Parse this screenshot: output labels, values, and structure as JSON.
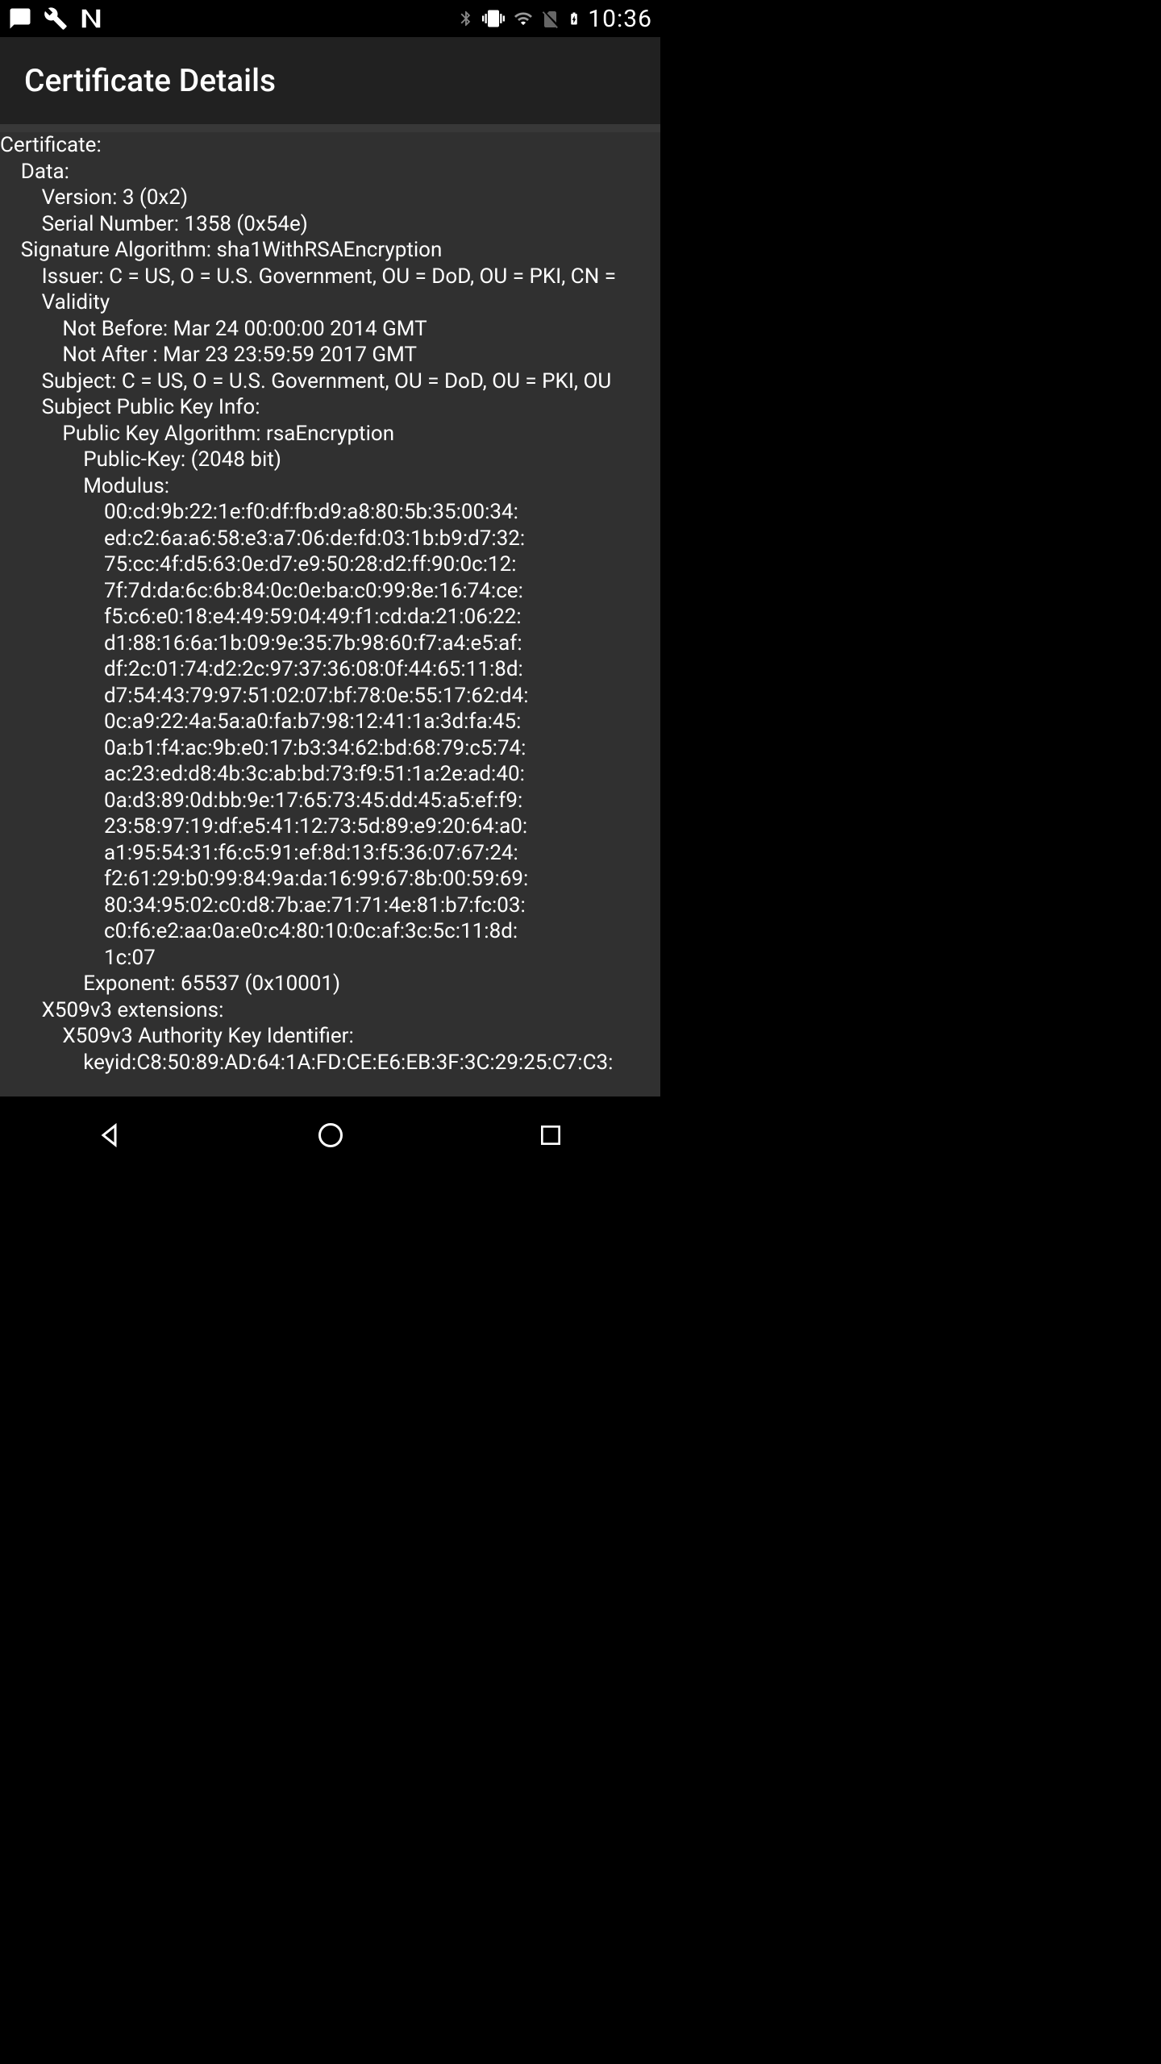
{
  "status": {
    "clock": "10:36"
  },
  "header": {
    "title": "Certificate Details"
  },
  "certificate": {
    "lines": [
      "Certificate:",
      "    Data:",
      "        Version: 3 (0x2)",
      "        Serial Number: 1358 (0x54e)",
      "    Signature Algorithm: sha1WithRSAEncryption",
      "        Issuer: C = US, O = U.S. Government, OU = DoD, OU = PKI, CN = ",
      "        Validity",
      "            Not Before: Mar 24 00:00:00 2014 GMT",
      "            Not After : Mar 23 23:59:59 2017 GMT",
      "        Subject: C = US, O = U.S. Government, OU = DoD, OU = PKI, OU ",
      "        Subject Public Key Info:",
      "            Public Key Algorithm: rsaEncryption",
      "                Public-Key: (2048 bit)",
      "                Modulus:",
      "                    00:cd:9b:22:1e:f0:df:fb:d9:a8:80:5b:35:00:34:",
      "                    ed:c2:6a:a6:58:e3:a7:06:de:fd:03:1b:b9:d7:32:",
      "                    75:cc:4f:d5:63:0e:d7:e9:50:28:d2:ff:90:0c:12:",
      "                    7f:7d:da:6c:6b:84:0c:0e:ba:c0:99:8e:16:74:ce:",
      "                    f5:c6:e0:18:e4:49:59:04:49:f1:cd:da:21:06:22:",
      "                    d1:88:16:6a:1b:09:9e:35:7b:98:60:f7:a4:e5:af:",
      "                    df:2c:01:74:d2:2c:97:37:36:08:0f:44:65:11:8d:",
      "                    d7:54:43:79:97:51:02:07:bf:78:0e:55:17:62:d4:",
      "                    0c:a9:22:4a:5a:a0:fa:b7:98:12:41:1a:3d:fa:45:",
      "                    0a:b1:f4:ac:9b:e0:17:b3:34:62:bd:68:79:c5:74:",
      "                    ac:23:ed:d8:4b:3c:ab:bd:73:f9:51:1a:2e:ad:40:",
      "                    0a:d3:89:0d:bb:9e:17:65:73:45:dd:45:a5:ef:f9:",
      "                    23:58:97:19:df:e5:41:12:73:5d:89:e9:20:64:a0:",
      "                    a1:95:54:31:f6:c5:91:ef:8d:13:f5:36:07:67:24:",
      "                    f2:61:29:b0:99:84:9a:da:16:99:67:8b:00:59:69:",
      "                    80:34:95:02:c0:d8:7b:ae:71:71:4e:81:b7:fc:03:",
      "                    c0:f6:e2:aa:0a:e0:c4:80:10:0c:af:3c:5c:11:8d:",
      "                    1c:07",
      "                Exponent: 65537 (0x10001)",
      "        X509v3 extensions:",
      "            X509v3 Authority Key Identifier:",
      "                keyid:C8:50:89:AD:64:1A:FD:CE:E6:EB:3F:3C:29:25:C7:C3:"
    ]
  }
}
